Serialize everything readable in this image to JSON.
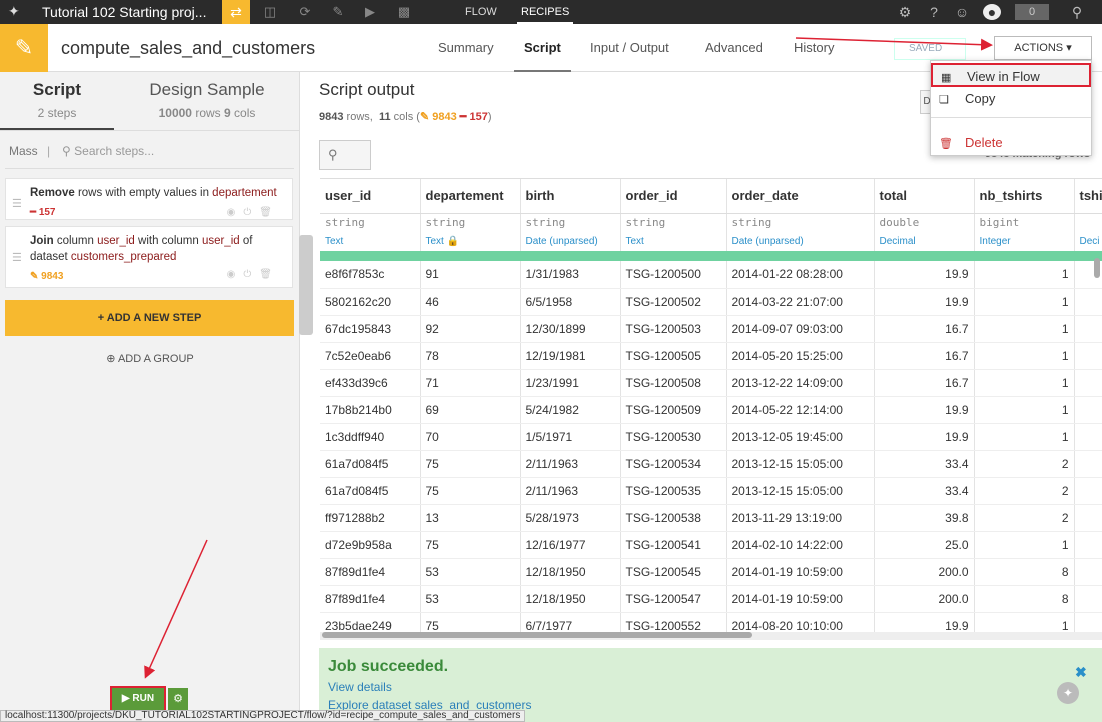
{
  "topnav": {
    "project_title": "Tutorial 102 Starting proj...",
    "tabs": [
      "FLOW",
      "RECIPES"
    ],
    "notification_count": "0"
  },
  "recipe": {
    "name": "compute_sales_and_customers",
    "tabs": [
      "Summary",
      "Script",
      "Input / Output",
      "Advanced",
      "History"
    ],
    "saved_label": "SAVED",
    "actions_label": "ACTIONS"
  },
  "actions_menu": {
    "items": [
      "View in Flow",
      "Copy",
      "Delete"
    ]
  },
  "left": {
    "tab_script": "Script",
    "tab_script_sub": "2 steps",
    "tab_design": "Design Sample",
    "tab_design_rows": "10000",
    "tab_design_rows_word": "rows",
    "tab_design_cols": "9",
    "tab_design_cols_word": "cols",
    "mass_label": "Mass",
    "search_placeholder": "Search steps...",
    "steps": [
      {
        "verb": "Remove",
        "rest": " rows with empty values in ",
        "col": "departement",
        "badge": "157"
      },
      {
        "verb": "Join",
        "pre1": " column ",
        "col1": "user_id",
        "pre2": " with column ",
        "col2": "user_id",
        "pre3": " of dataset ",
        "dataset": "customers_prepared",
        "badge": "9843"
      }
    ],
    "add_step_label": "+ ADD A NEW STEP",
    "add_group_label": "ADD A GROUP",
    "run_label": "RUN"
  },
  "output": {
    "title": "Script output",
    "rows": "9843",
    "rows_word": "rows,",
    "cols": "11",
    "cols_word": "cols",
    "badge_orange": "9843",
    "badge_red": "157",
    "matching_rows": "9843 matching rows",
    "columns": [
      {
        "name": "user_id",
        "storage": "string",
        "meaning": "Text"
      },
      {
        "name": "departement",
        "storage": "string",
        "meaning": "Text"
      },
      {
        "name": "birth",
        "storage": "string",
        "meaning": "Date (unparsed)"
      },
      {
        "name": "order_id",
        "storage": "string",
        "meaning": "Text"
      },
      {
        "name": "order_date",
        "storage": "string",
        "meaning": "Date (unparsed)"
      },
      {
        "name": "total",
        "storage": "double",
        "meaning": "Decimal"
      },
      {
        "name": "nb_tshirts",
        "storage": "bigint",
        "meaning": "Integer"
      },
      {
        "name": "tshi",
        "storage": "",
        "meaning": "Deci"
      }
    ],
    "rows_data": [
      [
        "e8f6f7853c",
        "91",
        "1/31/1983",
        "TSG-1200500",
        "2014-01-22 08:28:00",
        "19.9",
        "1"
      ],
      [
        "5802162c20",
        "46",
        "6/5/1958",
        "TSG-1200502",
        "2014-03-22 21:07:00",
        "19.9",
        "1"
      ],
      [
        "67dc195843",
        "92",
        "12/30/1899",
        "TSG-1200503",
        "2014-09-07 09:03:00",
        "16.7",
        "1"
      ],
      [
        "7c52e0eab6",
        "78",
        "12/19/1981",
        "TSG-1200505",
        "2014-05-20 15:25:00",
        "16.7",
        "1"
      ],
      [
        "ef433d39c6",
        "71",
        "1/23/1991",
        "TSG-1200508",
        "2013-12-22 14:09:00",
        "16.7",
        "1"
      ],
      [
        "17b8b214b0",
        "69",
        "5/24/1982",
        "TSG-1200509",
        "2014-05-22 12:14:00",
        "19.9",
        "1"
      ],
      [
        "1c3ddff940",
        "70",
        "1/5/1971",
        "TSG-1200530",
        "2013-12-05 19:45:00",
        "19.9",
        "1"
      ],
      [
        "61a7d084f5",
        "75",
        "2/11/1963",
        "TSG-1200534",
        "2013-12-15 15:05:00",
        "33.4",
        "2"
      ],
      [
        "61a7d084f5",
        "75",
        "2/11/1963",
        "TSG-1200535",
        "2013-12-15 15:05:00",
        "33.4",
        "2"
      ],
      [
        "ff971288b2",
        "13",
        "5/28/1973",
        "TSG-1200538",
        "2013-11-29 13:19:00",
        "39.8",
        "2"
      ],
      [
        "d72e9b958a",
        "75",
        "12/16/1977",
        "TSG-1200541",
        "2014-02-10 14:22:00",
        "25.0",
        "1"
      ],
      [
        "87f89d1fe4",
        "53",
        "12/18/1950",
        "TSG-1200545",
        "2014-01-19 10:59:00",
        "200.0",
        "8"
      ],
      [
        "87f89d1fe4",
        "53",
        "12/18/1950",
        "TSG-1200547",
        "2014-01-19 10:59:00",
        "200.0",
        "8"
      ],
      [
        "23b5dae249",
        "75",
        "6/7/1977",
        "TSG-1200552",
        "2014-08-20 10:10:00",
        "19.9",
        "1"
      ]
    ]
  },
  "job": {
    "title": "Job succeeded.",
    "link1": "View details",
    "link2": "Explore dataset sales_and_customers"
  },
  "statusbar": {
    "url": "localhost:11300/projects/DKU_TUTORIAL102STARTINGPROJECT/flow/?id=recipe_compute_sales_and_customers"
  }
}
